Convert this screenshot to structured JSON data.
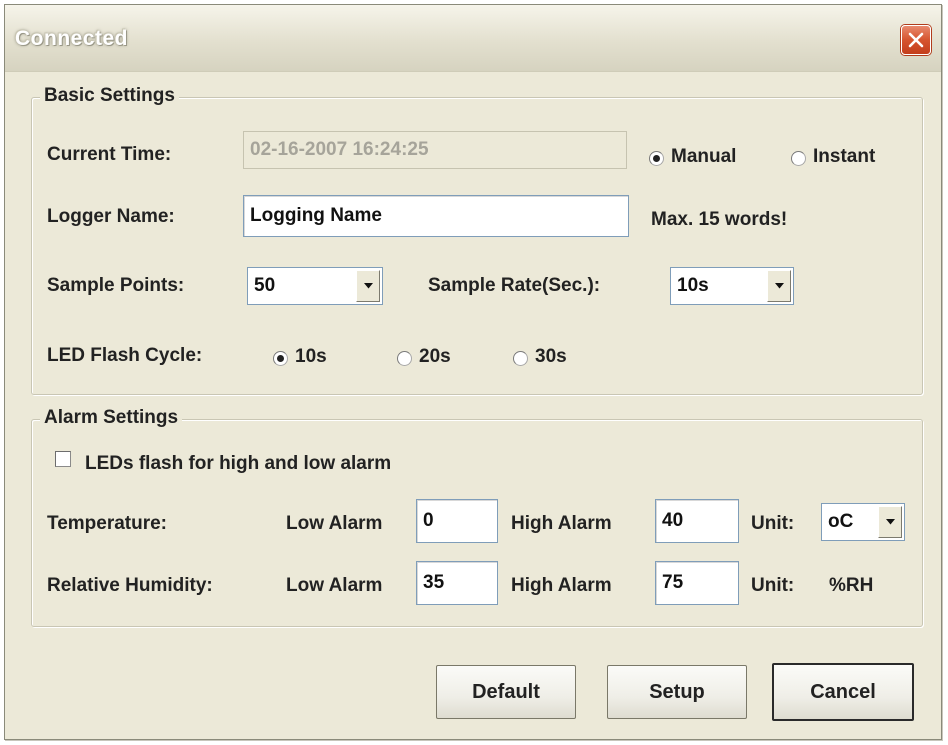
{
  "window": {
    "title": "Connected"
  },
  "basic": {
    "group_title": "Basic Settings",
    "current_time_label": "Current Time:",
    "current_time_value": "02-16-2007 16:24:25",
    "mode_options": [
      {
        "label": "Manual",
        "checked": true
      },
      {
        "label": "Instant",
        "checked": false
      }
    ],
    "logger_name_label": "Logger Name:",
    "logger_name_value": "Logging Name",
    "logger_name_hint": "Max. 15 words!",
    "sample_points_label": "Sample Points:",
    "sample_points_value": "50",
    "sample_rate_label": "Sample Rate(Sec.):",
    "sample_rate_value": "10s",
    "led_flash_label": "LED Flash Cycle:",
    "led_flash_options": [
      {
        "label": "10s",
        "checked": true
      },
      {
        "label": "20s",
        "checked": false
      },
      {
        "label": "30s",
        "checked": false
      }
    ]
  },
  "alarm": {
    "group_title": "Alarm Settings",
    "led_checkbox_label": "LEDs flash for high and low alarm",
    "led_checkbox_checked": false,
    "low_alarm_label": "Low Alarm",
    "high_alarm_label": "High Alarm",
    "unit_label": "Unit:",
    "temperature": {
      "label": "Temperature:",
      "low": "0",
      "high": "40",
      "unit": "oC"
    },
    "humidity": {
      "label": "Relative Humidity:",
      "low": "35",
      "high": "75",
      "unit": "%RH"
    }
  },
  "buttons": {
    "default_label": "Default",
    "setup_label": "Setup",
    "cancel_label": "Cancel"
  },
  "colors": {
    "dialog_background": "#ece9d8",
    "close_button": "#d6542f",
    "input_border": "#7f9db9"
  },
  "icons": {
    "close": "close-x-icon",
    "dropdown": "chevron-down-icon"
  }
}
